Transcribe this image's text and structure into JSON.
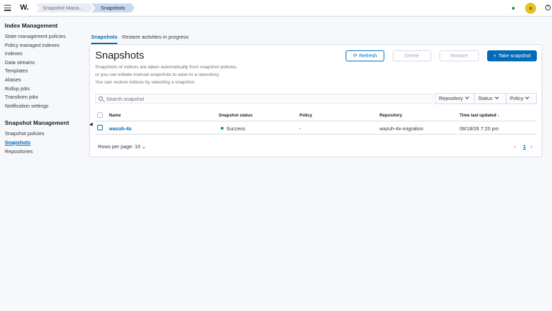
{
  "header": {
    "logo": "W.",
    "breadcrumbs": [
      "Snapshot Mana...",
      "Snapshots"
    ],
    "avatar_letter": "a",
    "status_color": "#1e8a5f"
  },
  "sidebar": {
    "sections": [
      {
        "title": "Index Management",
        "items": [
          "State management policies",
          "Policy managed indexes",
          "Indexes",
          "Data streams",
          "Templates",
          "Aliases",
          "Rollup jobs",
          "Transform jobs",
          "Notification settings"
        ]
      },
      {
        "title": "Snapshot Management",
        "items": [
          "Snapshot policies",
          "Snapshots",
          "Repositories"
        ]
      }
    ],
    "active_item": "Snapshots"
  },
  "tabs": [
    "Snapshots",
    "Restore activities in progress"
  ],
  "panel": {
    "title": "Snapshots",
    "description": [
      "Snapshots of indices are taken automatically from snapshot policies,",
      "or you can initiate manual snapshots to save to a repository.",
      "You can restore indices by selecting a snapshot."
    ],
    "buttons": {
      "refresh": "Refresh",
      "delete": "Delete",
      "restore": "Restore",
      "take_snapshot": "Take snapshot"
    },
    "search_placeholder": "Search snapshot",
    "filters": [
      "Repository",
      "Status",
      "Policy"
    ]
  },
  "table": {
    "columns": [
      "Name",
      "Snapshot status",
      "Policy",
      "Repository",
      "Time last updated"
    ],
    "sort_indicator": "↓",
    "rows": [
      {
        "name": "wazuh-4x",
        "status": "Success",
        "policy": "-",
        "repository": "wazuh-4x-migration",
        "time": "08/18/26 7:20 pm"
      }
    ]
  },
  "pagination": {
    "rows_per_page": "Rows per page: 10",
    "current_page": "1"
  },
  "colors": {
    "accent": "#006bb8",
    "success": "#1e8a5f",
    "avatar": "#e6c220"
  }
}
